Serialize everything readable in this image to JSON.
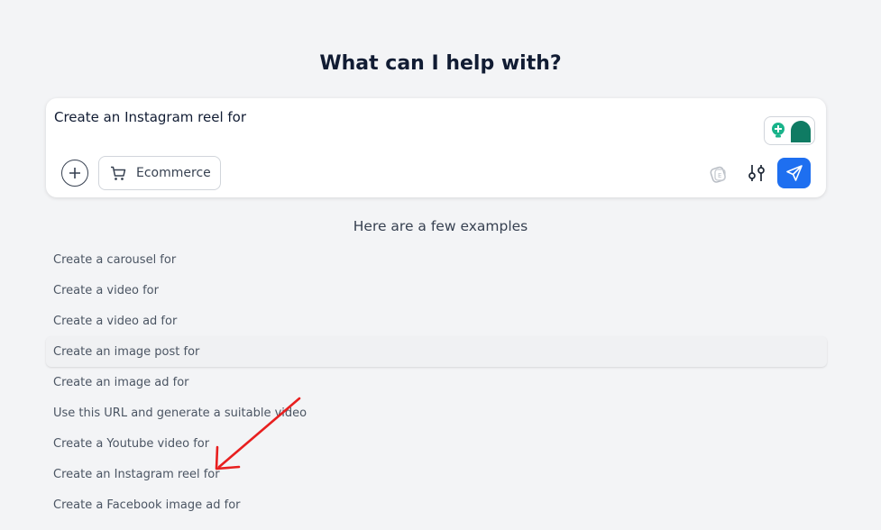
{
  "heading": "What can I help with?",
  "composer": {
    "input_text": "Create an Instagram reel for",
    "chip_label": "Ecommerce"
  },
  "colors": {
    "accent": "#1e6ff0",
    "assistant_green": "#0f7b63",
    "assistant_light": "#19b38a",
    "annotation_red": "#e81f1f"
  },
  "examples": {
    "heading": "Here are a few examples",
    "items": [
      "Create a carousel for",
      "Create a video for",
      "Create a video ad for",
      "Create an image post for",
      "Create an image ad for",
      "Use this URL and generate a suitable video",
      "Create a Youtube video for",
      "Create an Instagram reel for",
      "Create a Facebook image ad for"
    ],
    "hovered_index": 3
  }
}
